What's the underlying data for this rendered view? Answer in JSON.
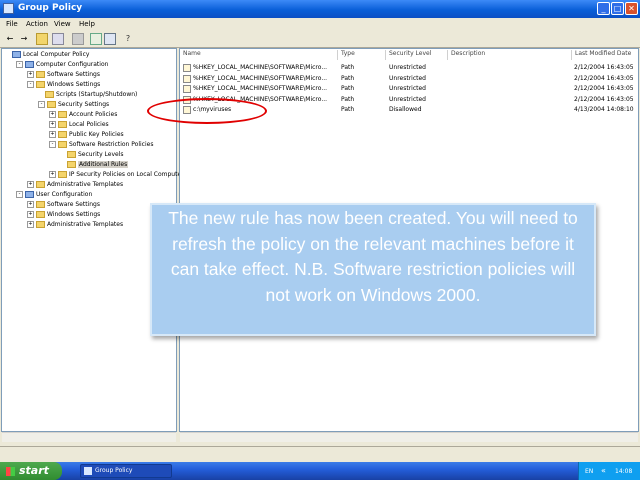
{
  "window": {
    "title": "Group Policy"
  },
  "menu": [
    "File",
    "Action",
    "View",
    "Help"
  ],
  "tree": [
    {
      "label": "Local Computer Policy",
      "level": 0,
      "icon": "computer-icon"
    },
    {
      "label": "Computer Configuration",
      "level": 1,
      "icon": "computer-icon",
      "expander": "-"
    },
    {
      "label": "Software Settings",
      "level": 2,
      "icon": "folder-icon",
      "expander": "+"
    },
    {
      "label": "Windows Settings",
      "level": 2,
      "icon": "folder-icon",
      "expander": "-"
    },
    {
      "label": "Scripts (Startup/Shutdown)",
      "level": 3,
      "icon": "folder-icon"
    },
    {
      "label": "Security Settings",
      "level": 3,
      "icon": "folder-icon",
      "expander": "-"
    },
    {
      "label": "Account Policies",
      "level": 4,
      "icon": "folder-icon",
      "expander": "+"
    },
    {
      "label": "Local Policies",
      "level": 4,
      "icon": "folder-icon",
      "expander": "+"
    },
    {
      "label": "Public Key Policies",
      "level": 4,
      "icon": "folder-icon",
      "expander": "+"
    },
    {
      "label": "Software Restriction Policies",
      "level": 4,
      "icon": "folder-icon",
      "expander": "-"
    },
    {
      "label": "Security Levels",
      "level": 5,
      "icon": "folder-icon"
    },
    {
      "label": "Additional Rules",
      "level": 5,
      "icon": "folder-icon",
      "selected": true
    },
    {
      "label": "IP Security Policies on Local Computer",
      "level": 4,
      "icon": "folder-icon",
      "expander": "+"
    },
    {
      "label": "Administrative Templates",
      "level": 2,
      "icon": "folder-icon",
      "expander": "+"
    },
    {
      "label": "User Configuration",
      "level": 1,
      "icon": "computer-icon",
      "expander": "-"
    },
    {
      "label": "Software Settings",
      "level": 2,
      "icon": "folder-icon",
      "expander": "+"
    },
    {
      "label": "Windows Settings",
      "level": 2,
      "icon": "folder-icon",
      "expander": "+"
    },
    {
      "label": "Administrative Templates",
      "level": 2,
      "icon": "folder-icon",
      "expander": "+"
    }
  ],
  "list": {
    "columns": [
      "Name",
      "Type",
      "Security Level",
      "Description",
      "Last Modified Date"
    ],
    "rows": [
      {
        "name": "%HKEY_LOCAL_MACHINE\\SOFTWARE\\Micro...",
        "type": "Path",
        "level": "Unrestricted",
        "description": "",
        "modified": "2/12/2004 16:43:05"
      },
      {
        "name": "%HKEY_LOCAL_MACHINE\\SOFTWARE\\Micro...",
        "type": "Path",
        "level": "Unrestricted",
        "description": "",
        "modified": "2/12/2004 16:43:05"
      },
      {
        "name": "%HKEY_LOCAL_MACHINE\\SOFTWARE\\Micro...",
        "type": "Path",
        "level": "Unrestricted",
        "description": "",
        "modified": "2/12/2004 16:43:05"
      },
      {
        "name": "%HKEY_LOCAL_MACHINE\\SOFTWARE\\Micro...",
        "type": "Path",
        "level": "Unrestricted",
        "description": "",
        "modified": "2/12/2004 16:43:05"
      },
      {
        "name": "c:\\myviruses",
        "type": "Path",
        "level": "Disallowed",
        "description": "",
        "modified": "4/13/2004 14:08:10"
      }
    ]
  },
  "callout": {
    "text": "The new rule has now been created. You will need to refresh the policy on the relevant machines before it can take effect. N.B. Software restriction policies will not work on Windows 2000."
  },
  "taskbar": {
    "start_label": "start",
    "task_label": "Group Policy",
    "lang": "EN",
    "clock": "14:08"
  },
  "colors": {
    "highlight_circle": "#e00000",
    "callout_bg": "#a9cdf0",
    "titlebar": "#0a5fd8"
  }
}
